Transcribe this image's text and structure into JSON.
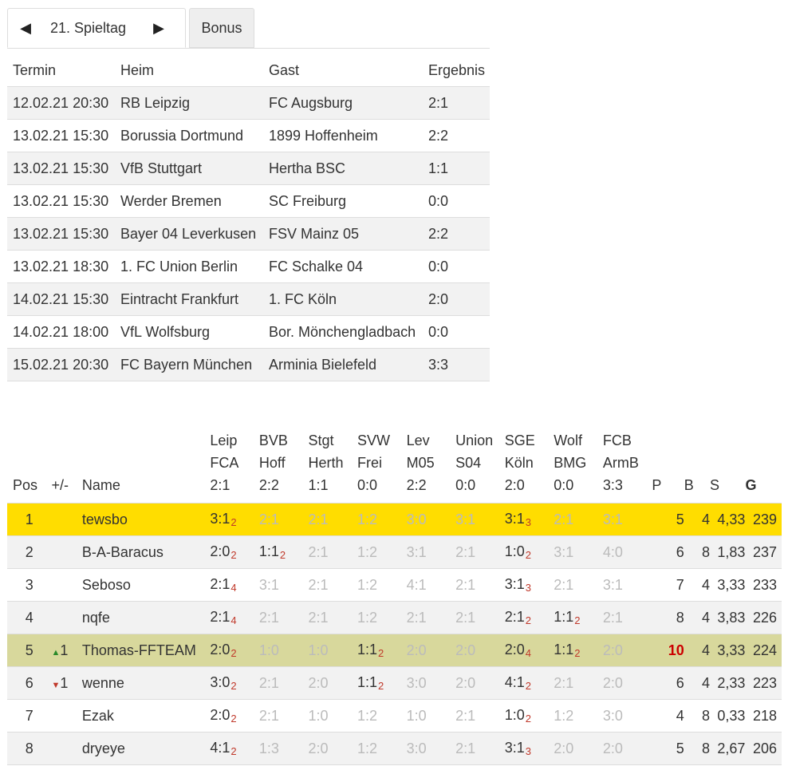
{
  "tabs": {
    "prev_arrow": "◀",
    "matchday": "21. Spieltag",
    "next_arrow": "▶",
    "bonus": "Bonus"
  },
  "fixtures": {
    "headers": [
      "Termin",
      "Heim",
      "Gast",
      "Ergebnis"
    ],
    "rows": [
      [
        "12.02.21 20:30",
        "RB Leipzig",
        "FC Augsburg",
        "2:1"
      ],
      [
        "13.02.21 15:30",
        "Borussia Dortmund",
        "1899 Hoffenheim",
        "2:2"
      ],
      [
        "13.02.21 15:30",
        "VfB Stuttgart",
        "Hertha BSC",
        "1:1"
      ],
      [
        "13.02.21 15:30",
        "Werder Bremen",
        "SC Freiburg",
        "0:0"
      ],
      [
        "13.02.21 15:30",
        "Bayer 04 Leverkusen",
        "FSV Mainz 05",
        "2:2"
      ],
      [
        "13.02.21 18:30",
        "1. FC Union Berlin",
        "FC Schalke 04",
        "0:0"
      ],
      [
        "14.02.21 15:30",
        "Eintracht Frankfurt",
        "1. FC Köln",
        "2:0"
      ],
      [
        "14.02.21 18:00",
        "VfL Wolfsburg",
        "Bor. Mönchengladbach",
        "0:0"
      ],
      [
        "15.02.21 20:30",
        "FC Bayern München",
        "Arminia Bielefeld",
        "3:3"
      ]
    ]
  },
  "standings": {
    "headers": {
      "pos": "Pos",
      "pm": "+/-",
      "name": "Name",
      "games": [
        {
          "home": "Leip",
          "away": "FCA",
          "result": "2:1"
        },
        {
          "home": "BVB",
          "away": "Hoff",
          "result": "2:2"
        },
        {
          "home": "Stgt",
          "away": "Herth",
          "result": "1:1"
        },
        {
          "home": "SVW",
          "away": "Frei",
          "result": "0:0"
        },
        {
          "home": "Lev",
          "away": "M05",
          "result": "2:2"
        },
        {
          "home": "Union",
          "away": "S04",
          "result": "0:0"
        },
        {
          "home": "SGE",
          "away": "Köln",
          "result": "2:0"
        },
        {
          "home": "Wolf",
          "away": "BMG",
          "result": "0:0"
        },
        {
          "home": "FCB",
          "away": "ArmB",
          "result": "3:3"
        }
      ],
      "p": "P",
      "b": "B",
      "s": "S",
      "g": "G"
    },
    "rows": [
      {
        "pos": "1",
        "pm_dir": "",
        "pm": "",
        "name": "tewsbo",
        "tips": [
          [
            "3:1",
            "2",
            false
          ],
          [
            "2:1",
            "",
            true
          ],
          [
            "2:1",
            "",
            true
          ],
          [
            "1:2",
            "",
            true
          ],
          [
            "3:0",
            "",
            true
          ],
          [
            "3:1",
            "",
            true
          ],
          [
            "3:1",
            "3",
            false
          ],
          [
            "2:1",
            "",
            true
          ],
          [
            "3:1",
            "",
            true
          ]
        ],
        "p": "5",
        "b": "4",
        "s": "4,33",
        "g": "239",
        "p_highlight": false
      },
      {
        "pos": "2",
        "pm_dir": "",
        "pm": "",
        "name": "B-A-Baracus",
        "tips": [
          [
            "2:0",
            "2",
            false
          ],
          [
            "1:1",
            "2",
            false
          ],
          [
            "2:1",
            "",
            true
          ],
          [
            "1:2",
            "",
            true
          ],
          [
            "3:1",
            "",
            true
          ],
          [
            "2:1",
            "",
            true
          ],
          [
            "1:0",
            "2",
            false
          ],
          [
            "3:1",
            "",
            true
          ],
          [
            "4:0",
            "",
            true
          ]
        ],
        "p": "6",
        "b": "8",
        "s": "1,83",
        "g": "237",
        "p_highlight": false
      },
      {
        "pos": "3",
        "pm_dir": "",
        "pm": "",
        "name": "Seboso",
        "tips": [
          [
            "2:1",
            "4",
            false
          ],
          [
            "3:1",
            "",
            true
          ],
          [
            "2:1",
            "",
            true
          ],
          [
            "1:2",
            "",
            true
          ],
          [
            "4:1",
            "",
            true
          ],
          [
            "2:1",
            "",
            true
          ],
          [
            "3:1",
            "3",
            false
          ],
          [
            "2:1",
            "",
            true
          ],
          [
            "3:1",
            "",
            true
          ]
        ],
        "p": "7",
        "b": "4",
        "s": "3,33",
        "g": "233",
        "p_highlight": false
      },
      {
        "pos": "4",
        "pm_dir": "",
        "pm": "",
        "name": "nqfe",
        "tips": [
          [
            "2:1",
            "4",
            false
          ],
          [
            "2:1",
            "",
            true
          ],
          [
            "2:1",
            "",
            true
          ],
          [
            "1:2",
            "",
            true
          ],
          [
            "2:1",
            "",
            true
          ],
          [
            "2:1",
            "",
            true
          ],
          [
            "2:1",
            "2",
            false
          ],
          [
            "1:1",
            "2",
            false
          ],
          [
            "2:1",
            "",
            true
          ]
        ],
        "p": "8",
        "b": "4",
        "s": "3,83",
        "g": "226",
        "p_highlight": false
      },
      {
        "pos": "5",
        "pm_dir": "up",
        "pm": "1",
        "name": "Thomas-FFTEAM",
        "tips": [
          [
            "2:0",
            "2",
            false
          ],
          [
            "1:0",
            "",
            true
          ],
          [
            "1:0",
            "",
            true
          ],
          [
            "1:1",
            "2",
            false
          ],
          [
            "2:0",
            "",
            true
          ],
          [
            "2:0",
            "",
            true
          ],
          [
            "2:0",
            "4",
            false
          ],
          [
            "1:1",
            "2",
            false
          ],
          [
            "2:0",
            "",
            true
          ]
        ],
        "p": "10",
        "b": "4",
        "s": "3,33",
        "g": "224",
        "p_highlight": true
      },
      {
        "pos": "6",
        "pm_dir": "down",
        "pm": "1",
        "name": "wenne",
        "tips": [
          [
            "3:0",
            "2",
            false
          ],
          [
            "2:1",
            "",
            true
          ],
          [
            "2:0",
            "",
            true
          ],
          [
            "1:1",
            "2",
            false
          ],
          [
            "3:0",
            "",
            true
          ],
          [
            "2:0",
            "",
            true
          ],
          [
            "4:1",
            "2",
            false
          ],
          [
            "2:1",
            "",
            true
          ],
          [
            "2:0",
            "",
            true
          ]
        ],
        "p": "6",
        "b": "4",
        "s": "2,33",
        "g": "223",
        "p_highlight": false
      },
      {
        "pos": "7",
        "pm_dir": "",
        "pm": "",
        "name": "Ezak",
        "tips": [
          [
            "2:0",
            "2",
            false
          ],
          [
            "2:1",
            "",
            true
          ],
          [
            "1:0",
            "",
            true
          ],
          [
            "1:2",
            "",
            true
          ],
          [
            "1:0",
            "",
            true
          ],
          [
            "2:1",
            "",
            true
          ],
          [
            "1:0",
            "2",
            false
          ],
          [
            "1:2",
            "",
            true
          ],
          [
            "3:0",
            "",
            true
          ]
        ],
        "p": "4",
        "b": "8",
        "s": "0,33",
        "g": "218",
        "p_highlight": false
      },
      {
        "pos": "8",
        "pm_dir": "",
        "pm": "",
        "name": "dryeye",
        "tips": [
          [
            "4:1",
            "2",
            false
          ],
          [
            "1:3",
            "",
            true
          ],
          [
            "2:0",
            "",
            true
          ],
          [
            "1:2",
            "",
            true
          ],
          [
            "3:0",
            "",
            true
          ],
          [
            "2:1",
            "",
            true
          ],
          [
            "3:1",
            "3",
            false
          ],
          [
            "2:0",
            "",
            true
          ],
          [
            "2:0",
            "",
            true
          ]
        ],
        "p": "5",
        "b": "8",
        "s": "2,67",
        "g": "206",
        "p_highlight": false
      }
    ]
  }
}
